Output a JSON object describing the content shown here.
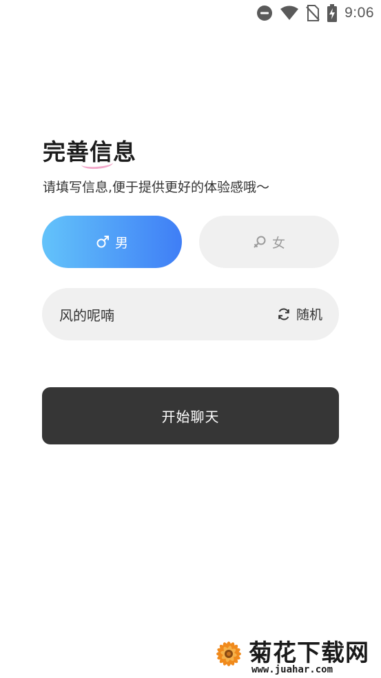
{
  "status_bar": {
    "time": "9:06",
    "icons": [
      "do-not-disturb-icon",
      "wifi-icon",
      "no-sim-icon",
      "battery-charging-icon"
    ]
  },
  "heading": {
    "title": "完善信息",
    "subtitle": "请填写信息,便于提供更好的体验感哦～"
  },
  "gender": {
    "male_label": "男",
    "female_label": "女",
    "male_icon": "male-symbol-icon",
    "female_icon": "female-symbol-icon",
    "selected": "male"
  },
  "nickname": {
    "value": "风的呢喃",
    "random_label": "随机",
    "random_icon": "refresh-icon"
  },
  "actions": {
    "start_chat_label": "开始聊天"
  },
  "watermark": {
    "title": "菊花下载网",
    "url": "www.juahar.com"
  },
  "colors": {
    "accent_gradient_start": "#63c3fa",
    "accent_gradient_end": "#3f7ef6",
    "field_bg": "#f0f0f0",
    "primary_button_bg": "#363636",
    "title_accent": "#f2a6c8"
  }
}
